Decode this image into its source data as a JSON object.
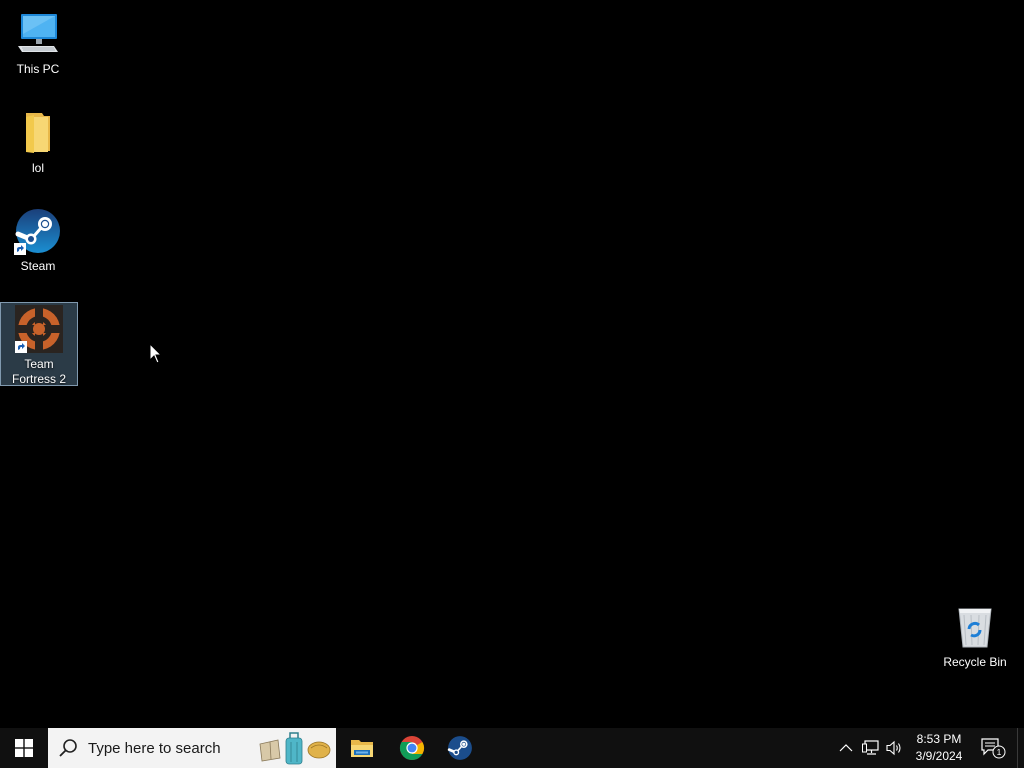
{
  "desktop": {
    "background_color": "#000000",
    "icons": [
      {
        "label": "This PC",
        "icon": "computer-icon"
      },
      {
        "label": "lol",
        "icon": "folder-icon"
      },
      {
        "label": "Steam",
        "icon": "steam-icon",
        "shortcut": true
      },
      {
        "label": "Team Fortress 2",
        "icon": "team-fortress-2-icon",
        "shortcut": true,
        "selected": true
      },
      {
        "label": "Recycle Bin",
        "icon": "recycle-bin-icon"
      }
    ]
  },
  "taskbar": {
    "background_color": "#101010",
    "start_icon": "windows-logo-icon",
    "search": {
      "placeholder": "Type here to search",
      "icon": "search-icon"
    },
    "pinned": [
      {
        "name": "File Explorer",
        "icon": "file-explorer-icon"
      },
      {
        "name": "Google Chrome",
        "icon": "chrome-icon"
      },
      {
        "name": "Steam",
        "icon": "steam-icon"
      }
    ],
    "tray": {
      "icons": [
        "chevron-up-icon",
        "network-icon",
        "volume-icon"
      ],
      "time": "8:53 PM",
      "date": "3/9/2024",
      "notification_count": "1"
    }
  }
}
